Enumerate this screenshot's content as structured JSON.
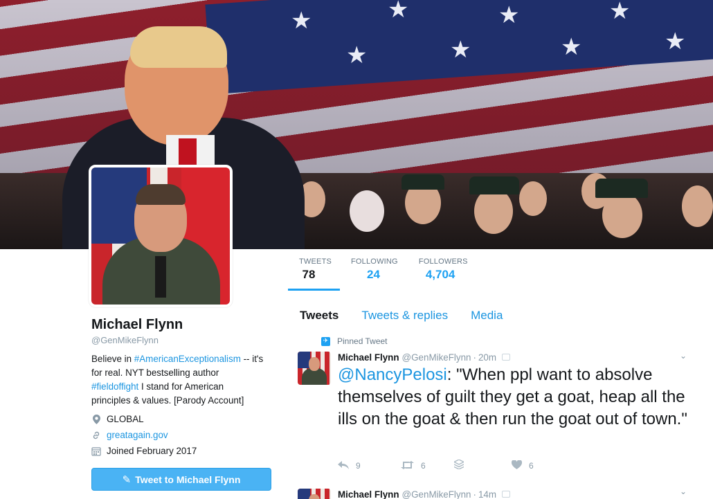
{
  "profile": {
    "name": "Michael Flynn",
    "handle": "@GenMikeFlynn",
    "bio": {
      "p1": "Believe in ",
      "tag1": "#AmericanExceptionalism",
      "p2": " -- it's for real. NYT bestselling author ",
      "tag2": "#fieldoffight",
      "p3": " I stand for American principles & values. [Parody Account]"
    },
    "location": "GLOBAL",
    "url": "greatagain.gov",
    "joined": "Joined February 2017",
    "tweet_button": "Tweet to Michael Flynn",
    "icons": {
      "location": "map-pin-icon",
      "url": "link-icon",
      "joined": "calendar-icon",
      "tweet_button": "quill-icon"
    }
  },
  "stats": {
    "tweets": {
      "label": "TWEETS",
      "value": "78"
    },
    "following": {
      "label": "FOLLOWING",
      "value": "24"
    },
    "followers": {
      "label": "FOLLOWERS",
      "value": "4,704"
    }
  },
  "tabs": [
    "Tweets",
    "Tweets & replies",
    "Media"
  ],
  "pinned_label": "Pinned Tweet",
  "tweets": [
    {
      "name": "Michael Flynn",
      "handle": "@GenMikeFlynn",
      "time": "20m",
      "mention": "@NancyPelosi",
      "text": ": \"When ppl want to absolve themselves of guilt they get a goat, heap all the ills on the goat & then run the goat out of town.\"",
      "replies": "9",
      "retweets": "6",
      "likes": "6"
    },
    {
      "name": "Michael Flynn",
      "handle": "@GenMikeFlynn",
      "time": "14m"
    }
  ],
  "colors": {
    "accent": "#1da1f2",
    "link": "#1b95e0",
    "button": "#4ab3f4"
  }
}
